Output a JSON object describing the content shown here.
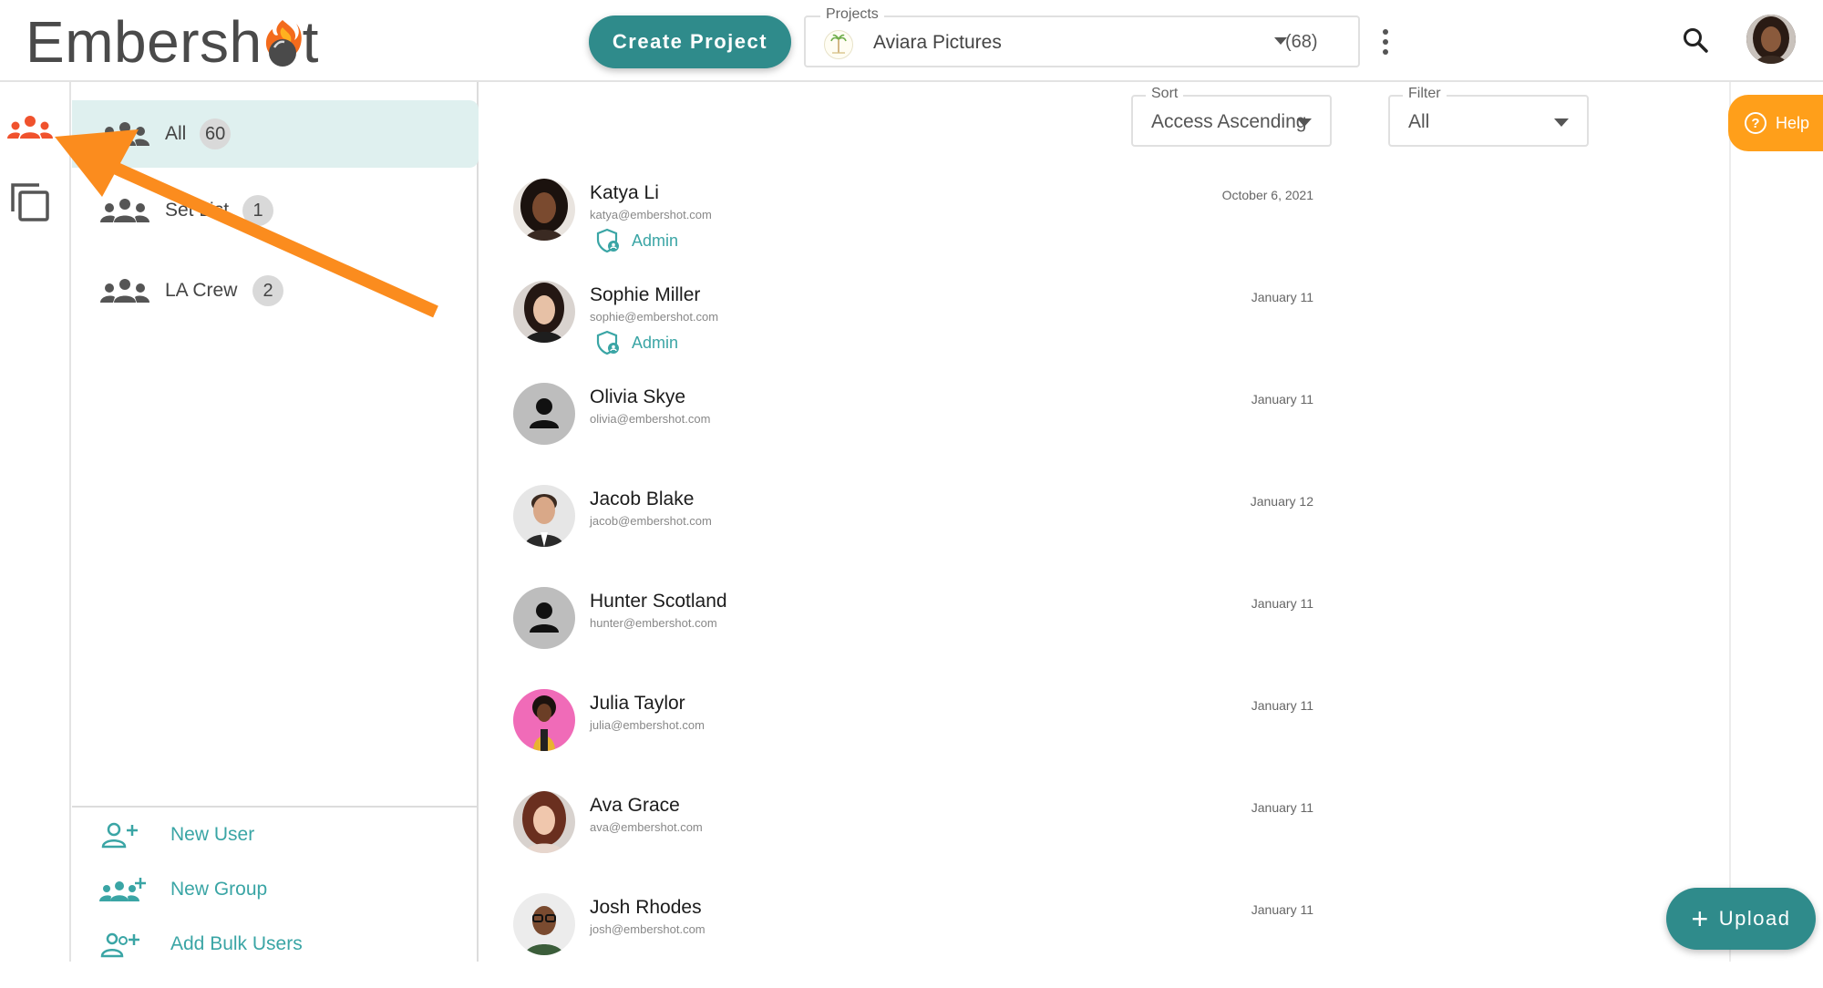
{
  "header": {
    "logo_text": "Embershot",
    "logo_left": "Embersh",
    "logo_right": "t",
    "create_project_label": "Create Project",
    "projects": {
      "legend": "Projects",
      "selected": "Aviara Pictures",
      "count": "(68)"
    },
    "more_icon": "kebab-icon",
    "search_icon": "search-icon"
  },
  "rail": {
    "items": [
      {
        "name": "users",
        "icon": "users-icon",
        "active_color": "#f0522d"
      },
      {
        "name": "copy",
        "icon": "copy-icon"
      }
    ]
  },
  "groups": {
    "items": [
      {
        "label": "All",
        "count": "60",
        "active": true
      },
      {
        "label": "Set List",
        "count": "1"
      },
      {
        "label": "LA Crew",
        "count": "2"
      }
    ],
    "actions": [
      {
        "label": "New User",
        "icon": "add-user-icon"
      },
      {
        "label": "New Group",
        "icon": "add-group-icon"
      },
      {
        "label": "Add Bulk Users",
        "icon": "add-bulk-users-icon"
      }
    ]
  },
  "main": {
    "sort": {
      "legend": "Sort",
      "value": "Access Ascending"
    },
    "filter": {
      "legend": "Filter",
      "value": "All"
    },
    "users": [
      {
        "name": "Katya Li",
        "email": "katya@embershot.com",
        "role": "Admin",
        "date": "October 6, 2021",
        "avatar": "photo"
      },
      {
        "name": "Sophie Miller",
        "email": "sophie@embershot.com",
        "role": "Admin",
        "date": "January 11",
        "avatar": "photo"
      },
      {
        "name": "Olivia Skye",
        "email": "olivia@embershot.com",
        "role": "",
        "date": "January 11",
        "avatar": "silhouette"
      },
      {
        "name": "Jacob Blake",
        "email": "jacob@embershot.com",
        "role": "",
        "date": "January 12",
        "avatar": "photo"
      },
      {
        "name": "Hunter Scotland",
        "email": "hunter@embershot.com",
        "role": "",
        "date": "January 11",
        "avatar": "silhouette"
      },
      {
        "name": "Julia Taylor",
        "email": "julia@embershot.com",
        "role": "",
        "date": "January 11",
        "avatar": "photo"
      },
      {
        "name": "Ava Grace",
        "email": "ava@embershot.com",
        "role": "",
        "date": "January 11",
        "avatar": "photo"
      },
      {
        "name": "Josh Rhodes",
        "email": "josh@embershot.com",
        "role": "",
        "date": "January 11",
        "avatar": "photo"
      }
    ]
  },
  "help_label": "Help",
  "upload_label": "Upload",
  "colors": {
    "accent": "#2f8b8b",
    "teal_text": "#3aa5a5",
    "help_orange": "#ff9f1a",
    "arrow_orange": "#fb8c1e",
    "active_group_bg": "#dff0ef"
  }
}
